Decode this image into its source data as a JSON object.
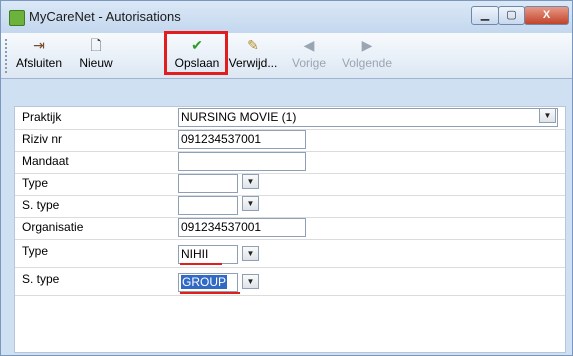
{
  "window": {
    "title": "MyCareNet - Autorisations",
    "min_glyph": "▁",
    "max_glyph": "▢",
    "close_glyph": "X"
  },
  "toolbar": {
    "buttons": [
      {
        "label": "Afsluiten",
        "icon": "door-exit-icon",
        "glyph": "⇥",
        "enabled": true
      },
      {
        "label": "Nieuw",
        "icon": "new-document-icon",
        "glyph": "🗋",
        "enabled": true
      },
      {
        "label": "Opslaan",
        "icon": "checkmark-icon",
        "glyph": "✔",
        "enabled": true
      },
      {
        "label": "Verwijd...",
        "icon": "eraser-icon",
        "glyph": "✎",
        "enabled": true
      },
      {
        "label": "Vorige",
        "icon": "arrow-left-icon",
        "glyph": "◀",
        "enabled": false
      },
      {
        "label": "Volgende",
        "icon": "arrow-right-icon",
        "glyph": "▶",
        "enabled": false
      }
    ],
    "highlight_color": "#e21d1d"
  },
  "form": {
    "praktijk_label": "Praktijk",
    "praktijk_value": "NURSING MOVIE (1)",
    "riziv_label": "Riziv nr",
    "riziv_value": "091234537001",
    "mandaat_label": "Mandaat",
    "mandaat_value": "",
    "type1_label": "Type",
    "type1_value": "",
    "stype1_label": "S. type",
    "stype1_value": "",
    "organisatie_label": "Organisatie",
    "organisatie_value": "091234537001",
    "type2_label": "Type",
    "type2_value": "NIHII",
    "stype2_label": "S. type",
    "stype2_value": "GROUP"
  },
  "combo_glyph": "▼"
}
